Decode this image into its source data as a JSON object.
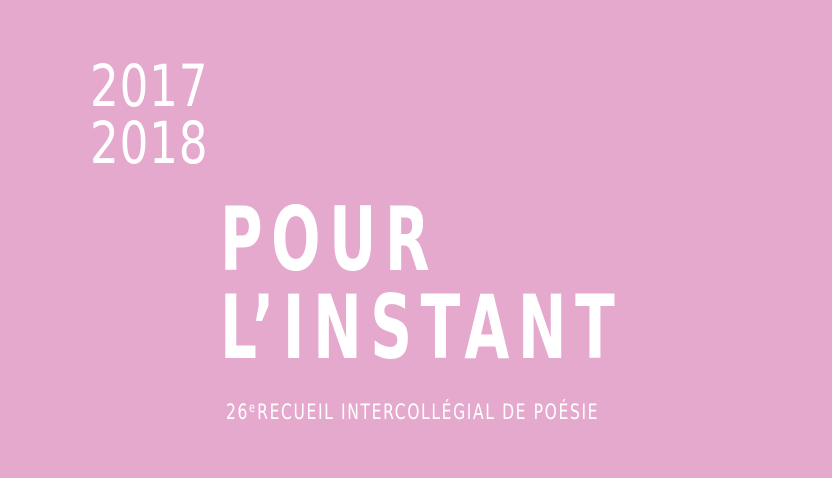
{
  "years": {
    "line1": "2017",
    "line2": "2018"
  },
  "title": {
    "line1": "POUR",
    "line2": "L’INSTANT"
  },
  "subtitle": {
    "number": "26",
    "superscript": "e",
    "text": "RECUEIL INTERCOLLÉGIAL DE POÉSIE"
  },
  "colors": {
    "background": "#e6a9ce",
    "text": "#ffffff"
  }
}
